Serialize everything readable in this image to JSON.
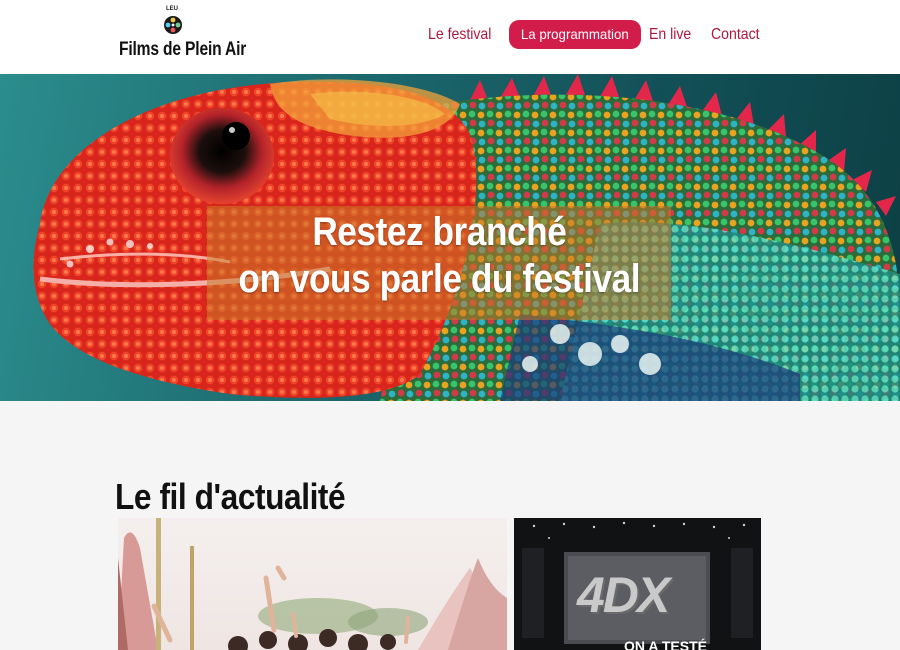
{
  "header": {
    "logo_small": "LEU",
    "logo_text": "Films de Plein Air",
    "nav": [
      {
        "label": "Le festival"
      },
      {
        "label": "La programmation",
        "active": true
      },
      {
        "label": "En live"
      },
      {
        "label": "Contact"
      }
    ]
  },
  "hero": {
    "line1": "Restez branché",
    "line2": "on vous parle du festival"
  },
  "news": {
    "title": "Le fil d'actualité",
    "cards": [
      {
        "image": "festival-crowd-photo"
      },
      {
        "image": "cinema-4dx-photo",
        "brand": "4DX",
        "caption": "ON A TESTÉ"
      }
    ]
  },
  "colors": {
    "accent": "#d21c4a",
    "nav_text": "#b0173f",
    "page_bg": "#f5f5f5"
  }
}
